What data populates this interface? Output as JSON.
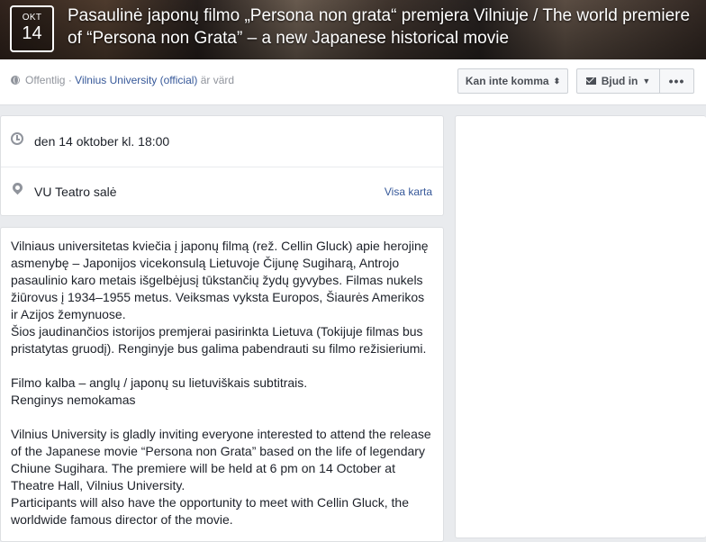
{
  "event": {
    "month": "OKT",
    "day": "14",
    "title": "Pasaulinė japonų filmo „Persona non grata“ premjera Vilniuje / The world premiere of “Persona non Grata” – a new Japanese historical movie"
  },
  "meta": {
    "privacy": "Offentlig",
    "separator": " · ",
    "host": "Vilnius University (official)",
    "host_suffix": " är värd"
  },
  "actions": {
    "going_label": "Kan inte komma",
    "invite_label": "Bjud in",
    "more_label": "•••"
  },
  "details": {
    "time": "den 14 oktober kl. 18:00",
    "place": "VU Teatro salė",
    "map_link": "Visa karta"
  },
  "description": "Vilniaus universitetas kviečia į japonų filmą (rež. Cellin Gluck) apie herojinę asmenybę – Japonijos vicekonsulą Lietuvoje Čijunę Sugiharą, Antrojo pasaulinio karo metais išgelbėjusį tūkstančių žydų gyvybes. Filmas nukels žiūrovus į 1934–1955 metus. Veiksmas vyksta Europos, Šiaurės Amerikos ir Azijos žemynuose.\nŠios jaudinančios istorijos premjerai pasirinkta Lietuva (Tokijuje filmas bus pristatytas gruodį). Renginyje bus galima pabendrauti su filmo režisieriumi.\n\nFilmo kalba – anglų / japonų su lietuviškais subtitrais.\nRenginys nemokamas\n\nVilnius University is gladly inviting everyone interested to attend the release of the Japanese movie “Persona non Grata” based on the life of legendary Chiune Sugihara. The premiere will be held at 6 pm on 14 October at Theatre Hall, Vilnius University.\nParticipants will also have the opportunity to meet with Cellin Gluck, the worldwide famous director of the movie."
}
